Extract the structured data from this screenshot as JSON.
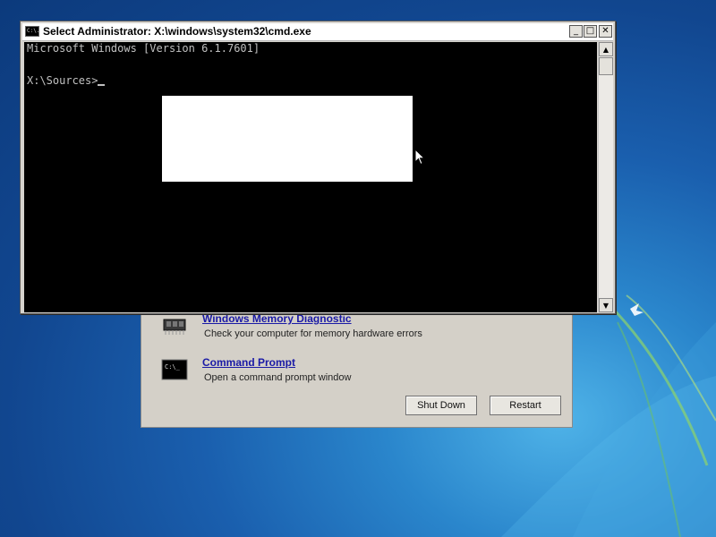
{
  "recovery": {
    "tools": [
      {
        "title": "Windows Memory Diagnostic",
        "description": "Check your computer for memory hardware errors"
      },
      {
        "title": "Command Prompt",
        "description": "Open a command prompt window"
      }
    ],
    "shutdown_label": "Shut Down",
    "restart_label": "Restart"
  },
  "cmd": {
    "title": "Select Administrator: X:\\windows\\system32\\cmd.exe",
    "icon_text": "C:\\.",
    "lines": [
      "Microsoft Windows [Version 6.1.7601]",
      "X:\\Sources>"
    ],
    "minimize_glyph": "_",
    "maximize_glyph": "□",
    "close_glyph": "✕",
    "scroll_up_glyph": "▲",
    "scroll_down_glyph": "▼"
  },
  "colors": {
    "console_bg": "#000000",
    "console_fg": "#c0c0c0",
    "link": "#1a1aa6",
    "dialog": "#d4d0c8"
  }
}
